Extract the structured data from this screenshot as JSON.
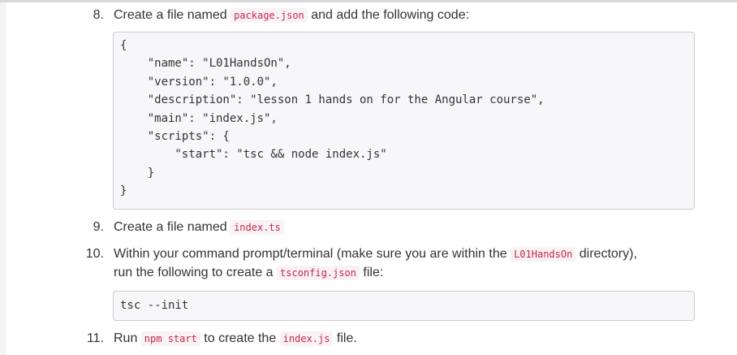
{
  "step8": {
    "number": "8.",
    "text_before": "Create a file named ",
    "code": "package.json",
    "text_after": " and add the following code:"
  },
  "package_json_code": [
    "{",
    "    \"name\": \"L01HandsOn\",",
    "    \"version\": \"1.0.0\",",
    "    \"description\": \"lesson 1 hands on for the Angular course\",",
    "    \"main\": \"index.js\",",
    "    \"scripts\": {",
    "        \"start\": \"tsc && node index.js\"",
    "    }",
    "}"
  ],
  "step9": {
    "number": "9.",
    "text_before": "Create a file named ",
    "code": "index.ts"
  },
  "step10": {
    "number": "10.",
    "line1_before": "Within your command prompt/terminal (make sure you are within the ",
    "line1_code": "L01HandsOn",
    "line1_after": " directory),",
    "line2_before": "run the following to create a ",
    "line2_code": "tsconfig.json",
    "line2_after": " file:"
  },
  "tsc_command": "tsc --init",
  "step11": {
    "number": "11.",
    "text_before": "Run ",
    "code1": "npm start",
    "text_middle": " to create the ",
    "code2": "index.js",
    "text_after": " file."
  }
}
